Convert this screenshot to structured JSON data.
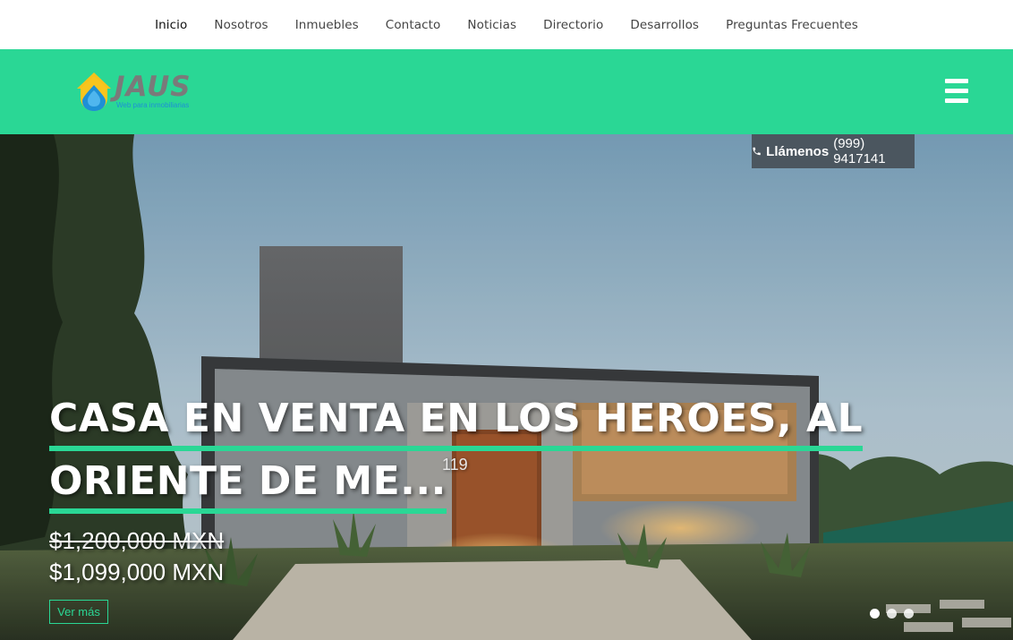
{
  "nav": {
    "items": [
      {
        "label": "Inicio",
        "active": true
      },
      {
        "label": "Nosotros"
      },
      {
        "label": "Inmuebles"
      },
      {
        "label": "Contacto"
      },
      {
        "label": "Noticias"
      },
      {
        "label": "Directorio"
      },
      {
        "label": "Desarrollos"
      },
      {
        "label": "Preguntas Frecuentes"
      }
    ]
  },
  "header": {
    "logo_word": "JAUS",
    "logo_tagline": "Web para inmobiliarias",
    "menu_icon": "hamburger-icon",
    "bg_color": "#2ad795"
  },
  "call": {
    "icon": "phone-icon",
    "label": "Llámenos",
    "phone": "(999) 9417141"
  },
  "slide": {
    "title_line1": "CASA EN VENTA EN LOS HEROES, AL",
    "title_line2": "ORIENTE DE ME...",
    "counter": "119",
    "price_old": "$1,200,000 MXN",
    "price_new": "$1,099,000 MXN",
    "more_label": "Ver más",
    "dots": 3,
    "active_dot": 0
  },
  "colors": {
    "accent": "#2ad795",
    "call_bg": "#4b565f"
  }
}
